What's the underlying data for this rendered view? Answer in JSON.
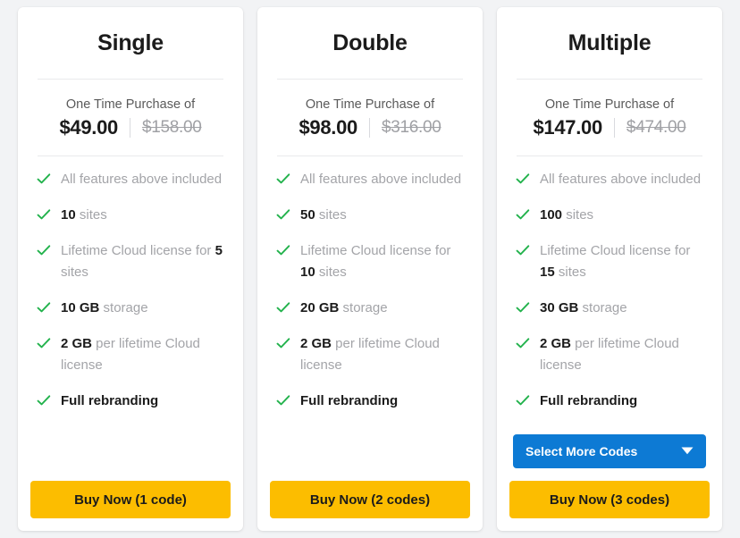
{
  "plans": [
    {
      "title": "Single",
      "price_caption": "One Time Purchase of",
      "price_now": "$49.00",
      "price_was": "$158.00",
      "features": [
        {
          "icon": "check-icon",
          "pre": "",
          "em": "",
          "post": "All features above included",
          "style": "muted"
        },
        {
          "icon": "check-icon",
          "pre": "",
          "em": "10",
          "post": " sites",
          "style": "mixed"
        },
        {
          "icon": "check-icon",
          "pre": "Lifetime Cloud license for ",
          "em": "5",
          "post": " sites",
          "style": "mixed"
        },
        {
          "icon": "check-icon",
          "pre": "",
          "em": "10 GB",
          "post": " storage",
          "style": "mixed"
        },
        {
          "icon": "check-icon",
          "pre": "",
          "em": "2 GB",
          "post": " per lifetime Cloud license",
          "style": "mixed"
        },
        {
          "icon": "check-icon",
          "pre": "",
          "em": "",
          "post": "Full rebranding",
          "style": "strong"
        }
      ],
      "dropdown": null,
      "buy_label": "Buy Now (1 code)"
    },
    {
      "title": "Double",
      "price_caption": "One Time Purchase of",
      "price_now": "$98.00",
      "price_was": "$316.00",
      "features": [
        {
          "icon": "check-icon",
          "pre": "",
          "em": "",
          "post": "All features above included",
          "style": "muted"
        },
        {
          "icon": "check-icon",
          "pre": "",
          "em": "50",
          "post": " sites",
          "style": "mixed"
        },
        {
          "icon": "check-icon",
          "pre": "Lifetime Cloud license for ",
          "em": "10",
          "post": " sites",
          "style": "mixed"
        },
        {
          "icon": "check-icon",
          "pre": "",
          "em": "20 GB",
          "post": " storage",
          "style": "mixed"
        },
        {
          "icon": "check-icon",
          "pre": "",
          "em": "2 GB",
          "post": " per lifetime Cloud license",
          "style": "mixed"
        },
        {
          "icon": "check-icon",
          "pre": "",
          "em": "",
          "post": "Full rebranding",
          "style": "strong"
        }
      ],
      "dropdown": null,
      "buy_label": "Buy Now (2 codes)"
    },
    {
      "title": "Multiple",
      "price_caption": "One Time Purchase of",
      "price_now": "$147.00",
      "price_was": "$474.00",
      "features": [
        {
          "icon": "check-icon",
          "pre": "",
          "em": "",
          "post": "All features above included",
          "style": "muted"
        },
        {
          "icon": "check-icon",
          "pre": "",
          "em": "100",
          "post": " sites",
          "style": "mixed"
        },
        {
          "icon": "check-icon",
          "pre": "Lifetime Cloud license for ",
          "em": "15",
          "post": " sites",
          "style": "mixed"
        },
        {
          "icon": "check-icon",
          "pre": "",
          "em": "30 GB",
          "post": " storage",
          "style": "mixed"
        },
        {
          "icon": "check-icon",
          "pre": "",
          "em": "2 GB",
          "post": " per lifetime Cloud license",
          "style": "mixed"
        },
        {
          "icon": "check-icon",
          "pre": "",
          "em": "",
          "post": "Full rebranding",
          "style": "strong"
        }
      ],
      "dropdown": {
        "label": "Select More Codes",
        "icon": "chevron-down-icon"
      },
      "buy_label": "Buy Now (3 codes)"
    }
  ],
  "colors": {
    "page_background": "#f2f3f5",
    "card_background": "#ffffff",
    "check_green": "#22b24c",
    "buy_amber": "#fcbd00",
    "dropdown_blue": "#0d7ad4",
    "text_dark": "#1b1b1b",
    "text_muted": "#a3a4a8",
    "divider": "#e9eaec"
  }
}
